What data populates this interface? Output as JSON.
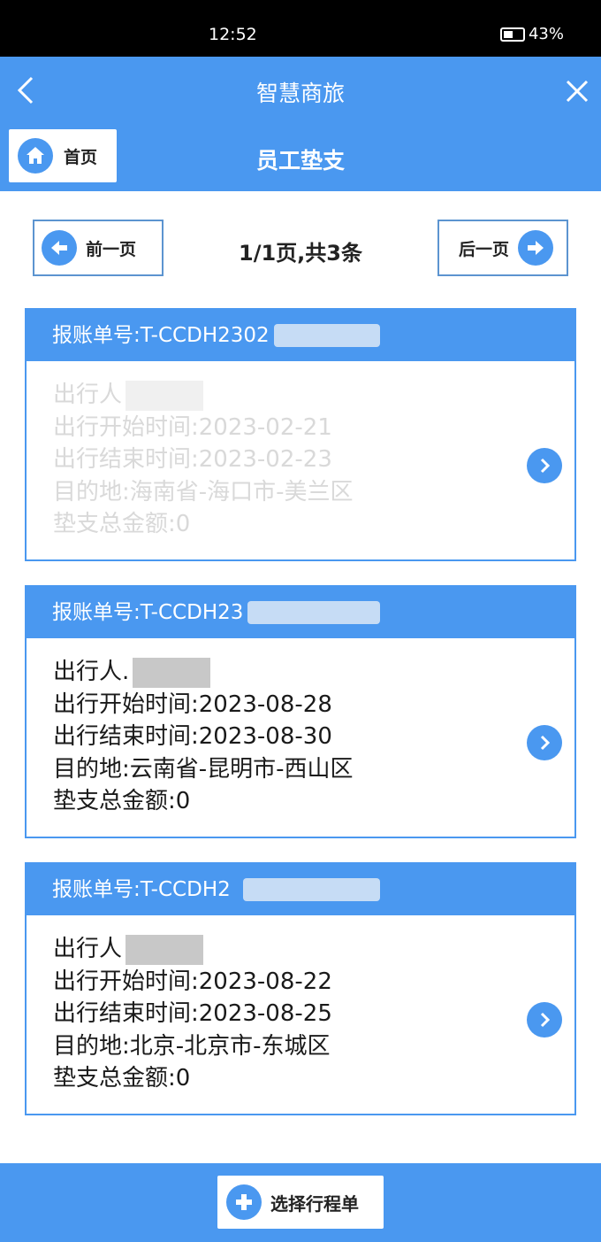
{
  "status_bar": {
    "time": "12:52",
    "battery": "43%"
  },
  "header": {
    "title": "智慧商旅"
  },
  "subheader": {
    "home_label": "首页",
    "page_title": "员工垫支"
  },
  "pager": {
    "prev_label": "前一页",
    "info": "1/1页,共3条",
    "next_label": "后一页"
  },
  "cards": [
    {
      "voucher": "报账单号:T-CCDH2302",
      "traveler": "出行人",
      "start": "出行开始时间:2023-02-21",
      "end": "出行结束时间:2023-02-23",
      "destination": "目的地:海南省-海口市-美兰区",
      "amount": "垫支总金额:0"
    },
    {
      "voucher": "报账单号:T-CCDH23",
      "traveler": "出行人.",
      "start": "出行开始时间:2023-08-28",
      "end": "出行结束时间:2023-08-30",
      "destination": "目的地:云南省-昆明市-西山区",
      "amount": "垫支总金额:0"
    },
    {
      "voucher": "报账单号:T-CCDH2",
      "traveler": "出行人",
      "start": "出行开始时间:2023-08-22",
      "end": "出行结束时间:2023-08-25",
      "destination": "目的地:北京-北京市-东城区",
      "amount": "垫支总金额:0"
    }
  ],
  "footer": {
    "select_label": "选择行程单"
  },
  "colors": {
    "primary": "#4a98f0",
    "border": "#5c94d0"
  },
  "icons": [
    "back-icon",
    "close-icon",
    "home-icon",
    "arrow-left-icon",
    "arrow-right-icon",
    "chevron-right-icon",
    "plus-icon"
  ]
}
